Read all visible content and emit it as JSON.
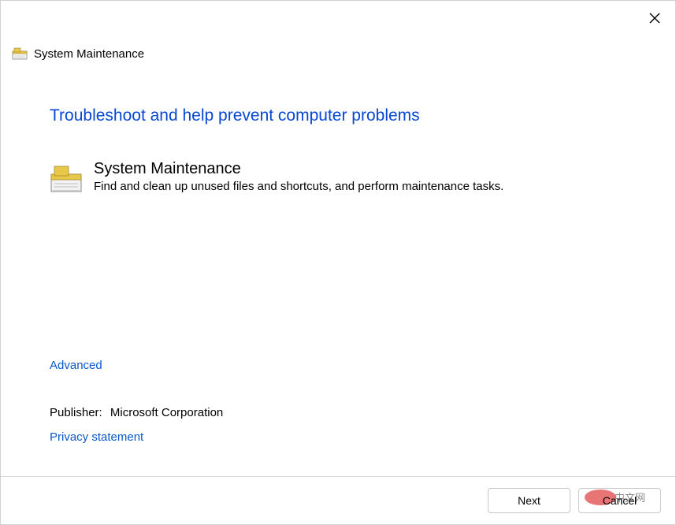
{
  "header": {
    "title": "System Maintenance"
  },
  "main": {
    "heading": "Troubleshoot and help prevent computer problems",
    "troubleshooter": {
      "title": "System Maintenance",
      "description": "Find and clean up unused files and shortcuts, and perform maintenance tasks."
    }
  },
  "links": {
    "advanced": "Advanced",
    "privacy": "Privacy statement"
  },
  "publisher": {
    "label": "Publisher:",
    "name": "Microsoft Corporation"
  },
  "footer": {
    "next": "Next",
    "cancel": "Cancel"
  },
  "watermark": {
    "text": "中文网"
  }
}
